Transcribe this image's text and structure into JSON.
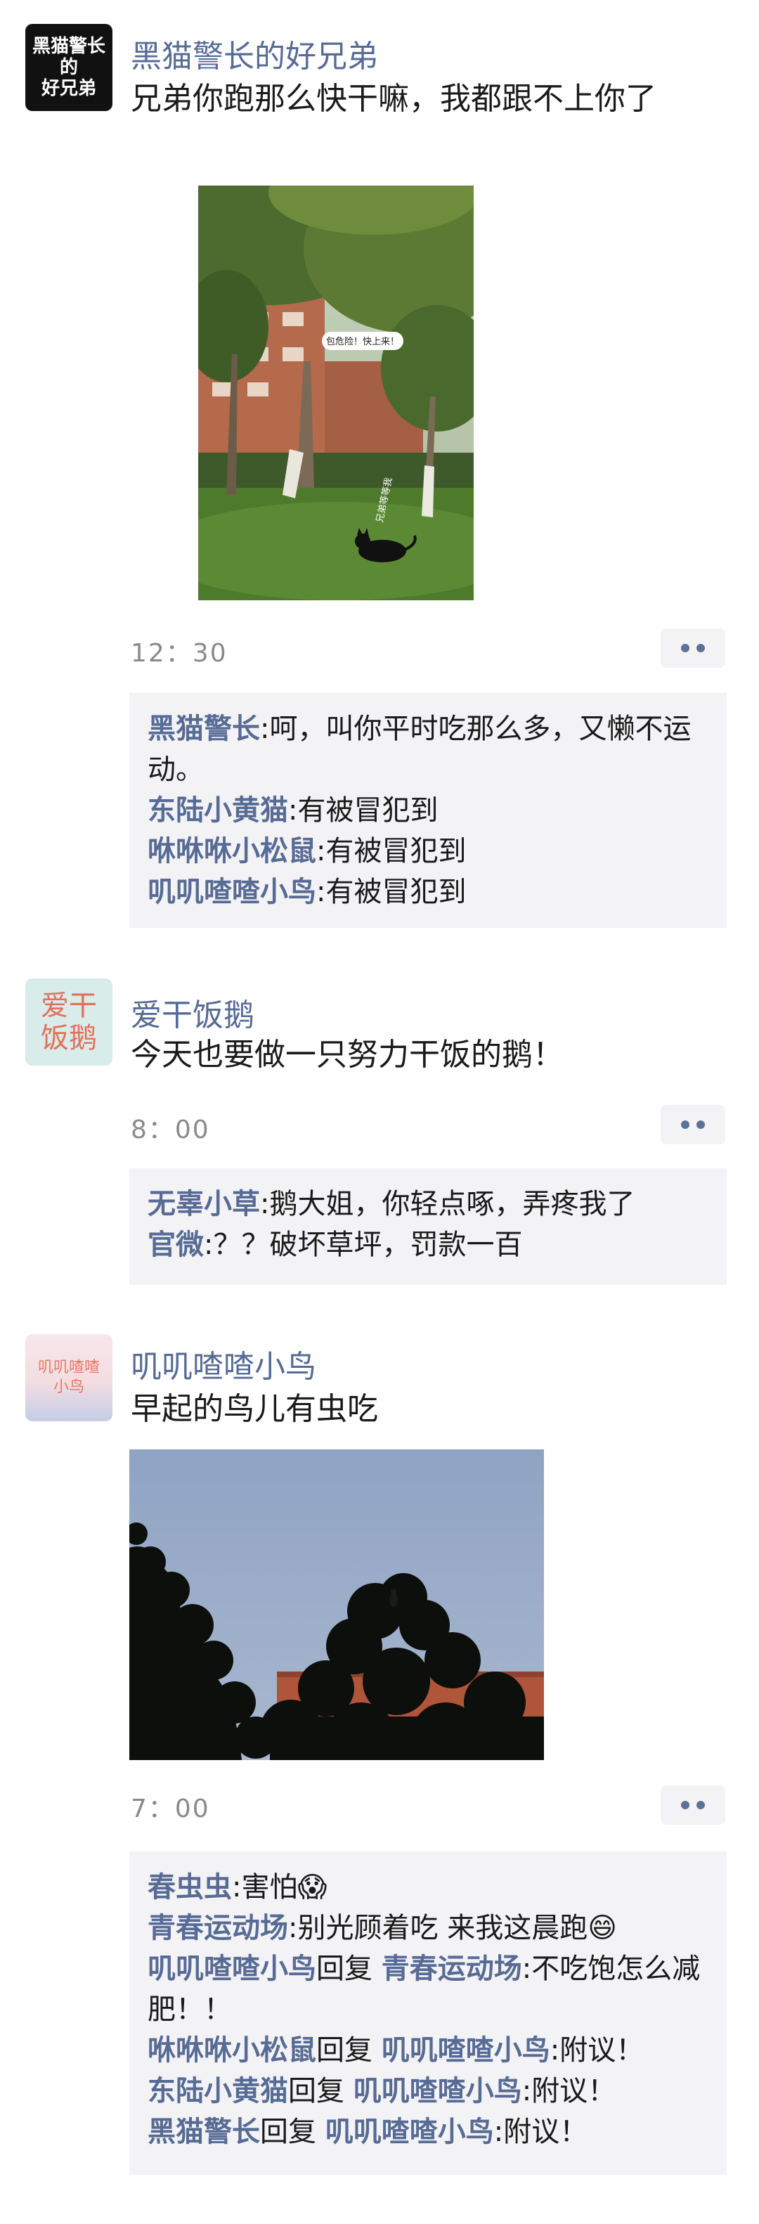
{
  "posts": [
    {
      "avatar_text": "黑猫警长的好兄弟",
      "avatar_lines": [
        "黑猫警长",
        "的",
        "好兄弟"
      ],
      "nickname": "黑猫警长的好兄弟",
      "text": "兄弟你跑那么快干嘛，我都跟不上你了",
      "photo_bubble": "包危险！快上来！",
      "photo_caption": "兄弟等等我",
      "time": "12：30",
      "comments": [
        {
          "name": "黑猫警长",
          "text": ":呵，叫你平时吃那么多，又懒不运动。"
        },
        {
          "name": "东陆小黄猫",
          "text": ":有被冒犯到"
        },
        {
          "name": "咻咻咻小松鼠",
          "text": ":有被冒犯到"
        },
        {
          "name": "叽叽喳喳小鸟",
          "text": ":有被冒犯到"
        }
      ]
    },
    {
      "avatar_line1": "爱干",
      "avatar_line2": "饭鹅",
      "nickname": "爱干饭鹅",
      "text": "今天也要做一只努力干饭的鹅！",
      "time": "8：00",
      "comments": [
        {
          "name": "无辜小草",
          "text": ":鹅大姐，你轻点啄，弄疼我了"
        },
        {
          "name": "官微",
          "text": ":？？破坏草坪，罚款一百"
        }
      ]
    },
    {
      "avatar_line1": "叽叽喳喳",
      "avatar_line2": "小鸟",
      "nickname": "叽叽喳喳小鸟",
      "text": "早起的鸟儿有虫吃",
      "time": "7：00",
      "comments": [
        {
          "name": "春虫虫",
          "text": ":害怕😱"
        },
        {
          "name": "青春运动场",
          "text": ":别光顾着吃 来我这晨跑😄"
        },
        {
          "name": "叽叽喳喳小鸟",
          "reply_word": "回复",
          "reply_to": "青春运动场",
          "text": ":不吃饱怎么减肥！！"
        },
        {
          "name": "咻咻咻小松鼠",
          "reply_word": "回复",
          "reply_to": "叽叽喳喳小鸟",
          "text": ":附议！"
        },
        {
          "name": "东陆小黄猫",
          "reply_word": "回复",
          "reply_to": "叽叽喳喳小鸟",
          "text": ":附议！"
        },
        {
          "name": "黑猫警长",
          "reply_word": "回复",
          "reply_to": "叽叽喳喳小鸟",
          "text": ":附议！"
        }
      ]
    }
  ],
  "colors": {
    "nickname": "#576b95",
    "comment_bg": "#f3f3f5",
    "time": "#8a8a8a"
  },
  "icons": {
    "more": "more-dots-icon"
  }
}
